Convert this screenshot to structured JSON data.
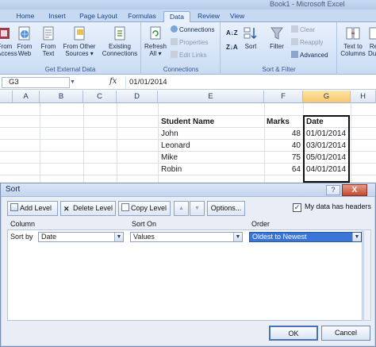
{
  "window": {
    "title": "Book1 - Microsoft Excel"
  },
  "ribbon": {
    "tabs": [
      {
        "label": "Home"
      },
      {
        "label": "Insert"
      },
      {
        "label": "Page Layout"
      },
      {
        "label": "Formulas"
      },
      {
        "label": "Data",
        "active": true
      },
      {
        "label": "Review"
      },
      {
        "label": "View"
      }
    ],
    "groups": {
      "external": {
        "label": "Get External Data",
        "from_access": [
          "From",
          "Access"
        ],
        "from_web": [
          "From",
          "Web"
        ],
        "from_text": [
          "From",
          "Text"
        ],
        "from_other": [
          "From Other",
          "Sources ▾"
        ],
        "existing": [
          "Existing",
          "Connections"
        ]
      },
      "connections": {
        "label": "Connections",
        "refresh": [
          "Refresh",
          "All ▾"
        ],
        "connections": "Connections",
        "properties": "Properties",
        "edit_links": "Edit Links"
      },
      "sortfilter": {
        "label": "Sort & Filter",
        "sort": "Sort",
        "filter": "Filter",
        "clear": "Clear",
        "reapply": "Reapply",
        "advanced": "Advanced"
      },
      "tools": {
        "text_to_columns": [
          "Text to",
          "Columns"
        ],
        "remove": [
          "Re",
          "Dup"
        ]
      }
    }
  },
  "formula_bar": {
    "name_box": "G3",
    "fx": "fx",
    "formula": "01/01/2014"
  },
  "grid": {
    "columns": [
      "A",
      "B",
      "C",
      "D",
      "E",
      "F",
      "G",
      "H"
    ],
    "selected_column": "G",
    "headers": {
      "name": "Student Name",
      "marks": "Marks",
      "date": "Date"
    },
    "rows": [
      {
        "name": "John",
        "marks": "48",
        "date": "01/01/2014"
      },
      {
        "name": "Leonard",
        "marks": "40",
        "date": "03/01/2014"
      },
      {
        "name": "Mike",
        "marks": "75",
        "date": "05/01/2014"
      },
      {
        "name": "Robin",
        "marks": "64",
        "date": "04/01/2014"
      }
    ]
  },
  "sort_dialog": {
    "title": "Sort",
    "help": "?",
    "close": "X",
    "toolbar": {
      "add_level": "Add Level",
      "delete_level": "Delete Level",
      "copy_level": "Copy Level",
      "move_up": "▲",
      "move_down": "▼",
      "options": "Options..."
    },
    "has_headers": {
      "label": "My data has headers",
      "checked": "✓"
    },
    "columns": {
      "column": "Column",
      "sort_on": "Sort On",
      "order": "Order"
    },
    "level": {
      "label": "Sort by",
      "column_value": "Date",
      "sort_on_value": "Values",
      "order_value": "Oldest to Newest"
    },
    "ok": "OK",
    "cancel": "Cancel"
  },
  "colors": {
    "accent": "#3875d7",
    "ribbon": "#d3e2f6",
    "selected_header": "#f9c86e"
  }
}
